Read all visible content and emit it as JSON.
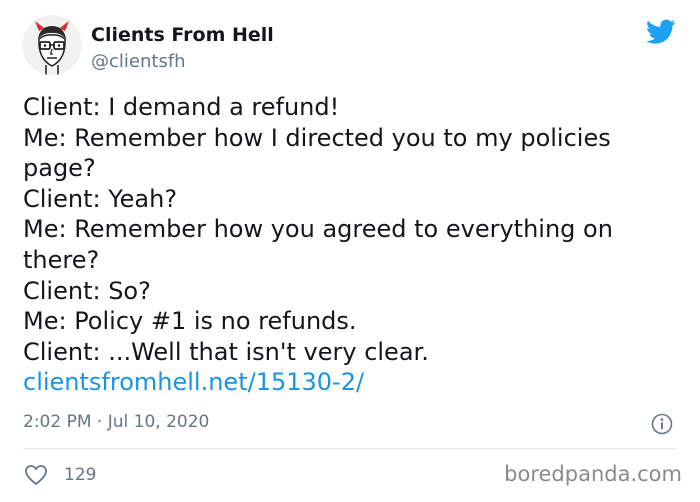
{
  "author": {
    "display_name": "Clients From Hell",
    "handle": "@clientsfh"
  },
  "tweet": {
    "lines": [
      "Client: I demand a refund!",
      "Me: Remember how I directed you to my policies",
      "page?",
      "Client: Yeah?",
      "Me: Remember how you agreed to everything on",
      "there?",
      "Client: So?",
      "Me: Policy #1 is no refunds.",
      "Client: ...Well that isn't very clear."
    ],
    "link": "clientsfromhell.net/15130-2/",
    "timestamp": "2:02 PM · Jul 10, 2020"
  },
  "actions": {
    "like_count": "129"
  },
  "watermark": "boredpanda.com",
  "icons": {
    "avatar": "devil-horns-avatar",
    "brand": "twitter-bird-icon",
    "info": "info-icon",
    "like": "heart-icon"
  },
  "colors": {
    "link": "#1b95e0",
    "twitter_blue": "#1da1f2",
    "muted": "#657786",
    "text": "#14171a"
  }
}
